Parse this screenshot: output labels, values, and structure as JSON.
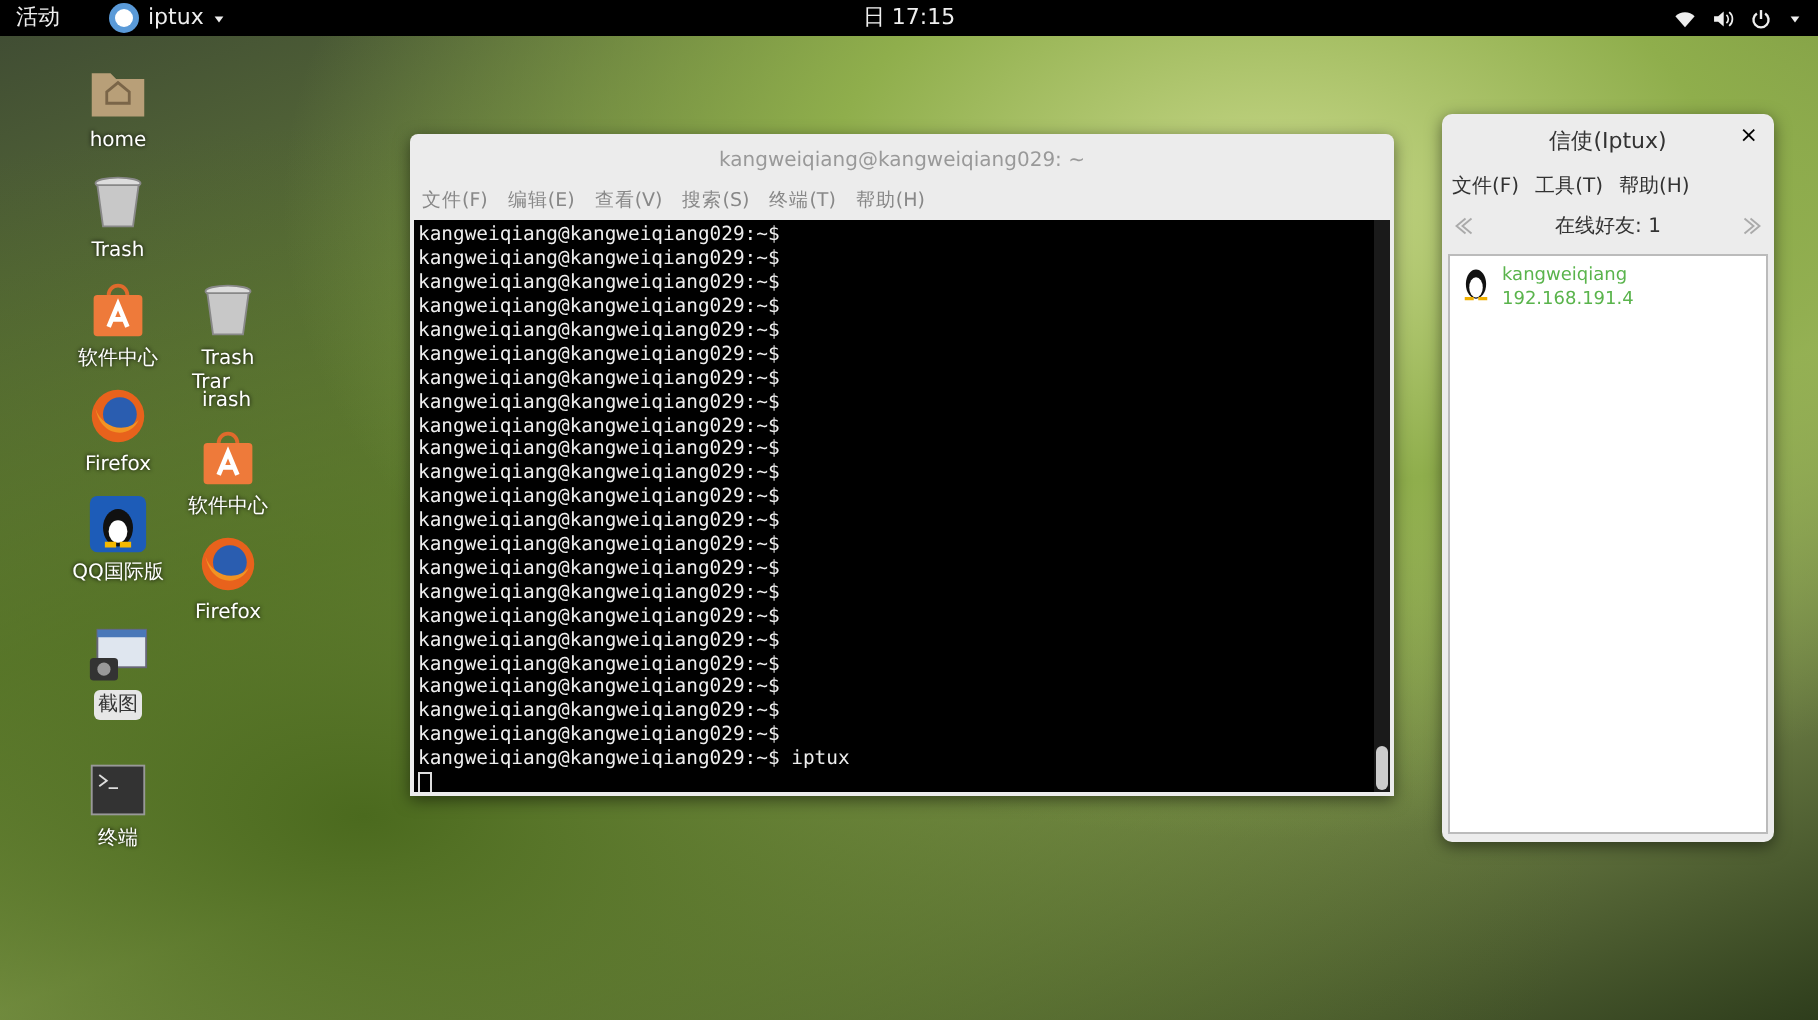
{
  "top_bar": {
    "activities": "活动",
    "app_menu": "iptux",
    "clock": "日 17:15"
  },
  "desktop_columns": [
    {
      "icons": [
        {
          "kind": "home",
          "label": "home",
          "selected": false
        },
        {
          "kind": "trash",
          "label": "Trash",
          "selected": false
        },
        {
          "kind": "store",
          "label": "软件中心",
          "selected": false
        },
        {
          "kind": "firefox",
          "label": "Firefox",
          "selected": false
        },
        {
          "kind": "qq",
          "label": "QQ国际版",
          "selected": false
        },
        {
          "kind": "screenshot",
          "label": "截图",
          "selected": true
        },
        {
          "kind": "terminal",
          "label": "终端",
          "selected": false
        }
      ]
    },
    {
      "icons": [
        {
          "kind": "trash",
          "label": "Trash",
          "selected": false
        },
        {
          "kind": "store",
          "label": "软件中心",
          "selected": false
        },
        {
          "kind": "firefox",
          "label": "Firefox",
          "selected": false
        }
      ]
    }
  ],
  "ghost_labels": [
    "Trar",
    "irash"
  ],
  "terminal": {
    "title": "kangweiqiang@kangweiqiang029: ~",
    "menu": [
      "文件(F)",
      "编辑(E)",
      "查看(V)",
      "搜索(S)",
      "终端(T)",
      "帮助(H)"
    ],
    "lines": [
      "kangweiqiang@kangweiqiang029:~$",
      "kangweiqiang@kangweiqiang029:~$",
      "kangweiqiang@kangweiqiang029:~$",
      "kangweiqiang@kangweiqiang029:~$",
      "kangweiqiang@kangweiqiang029:~$",
      "kangweiqiang@kangweiqiang029:~$",
      "kangweiqiang@kangweiqiang029:~$",
      "kangweiqiang@kangweiqiang029:~$",
      "kangweiqiang@kangweiqiang029:~$",
      "kangweiqiang@kangweiqiang029:~$",
      "kangweiqiang@kangweiqiang029:~$",
      "kangweiqiang@kangweiqiang029:~$",
      "kangweiqiang@kangweiqiang029:~$",
      "kangweiqiang@kangweiqiang029:~$",
      "kangweiqiang@kangweiqiang029:~$",
      "kangweiqiang@kangweiqiang029:~$",
      "kangweiqiang@kangweiqiang029:~$",
      "kangweiqiang@kangweiqiang029:~$",
      "kangweiqiang@kangweiqiang029:~$",
      "kangweiqiang@kangweiqiang029:~$",
      "kangweiqiang@kangweiqiang029:~$",
      "kangweiqiang@kangweiqiang029:~$",
      "kangweiqiang@kangweiqiang029:~$ iptux"
    ]
  },
  "iptux": {
    "title": "信使(Iptux)",
    "close": "×",
    "menu": [
      "文件(F)",
      "工具(T)",
      "帮助(H)"
    ],
    "online": "在线好友: 1",
    "friends": [
      {
        "name": "kangweiqiang",
        "ip": "192.168.191.4"
      }
    ]
  }
}
